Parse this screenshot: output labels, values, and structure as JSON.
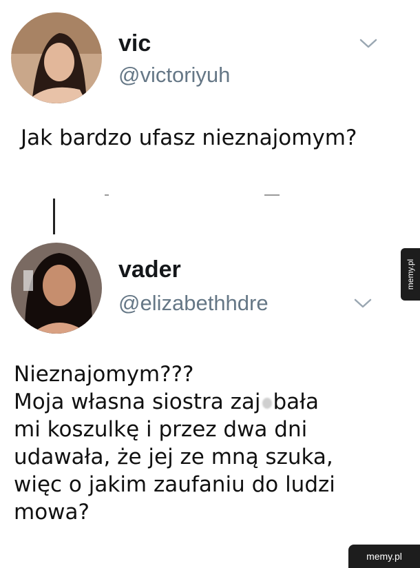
{
  "tweet1": {
    "name": "vic",
    "handle": "@victoriyuh",
    "text": "Jak bardzo ufasz nieznajomym?"
  },
  "tweet2": {
    "name": "vader",
    "handle": "@elizabethhdre",
    "lines": [
      "Nieznajomym???",
      "Moja własna siostra zaj",
      "bała",
      "mi koszulkę i przez dwa dni",
      "udawała, że jej ze mną szuka,",
      "więc o jakim zaufaniu do ludzi",
      "mowa?"
    ]
  },
  "watermark": {
    "side": "memy.pl",
    "corner": "memy.pl"
  },
  "icons": [
    "chevron-down-icon",
    "avatar"
  ],
  "colors": {
    "text": "#14171a",
    "handle": "#657786",
    "tab": "#1d1d1d"
  }
}
